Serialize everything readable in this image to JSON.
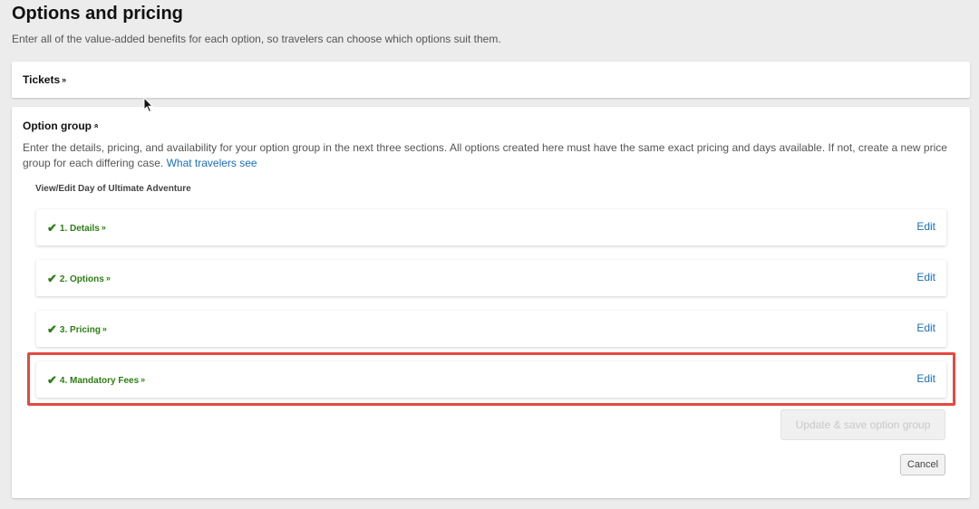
{
  "header": {
    "title": "Options and pricing",
    "subtitle": "Enter all of the value-added benefits for each option, so travelers can choose which options suit them."
  },
  "tickets": {
    "label": "Tickets",
    "toggle_icon": "double-chevron-down-icon"
  },
  "option_group": {
    "label": "Option group",
    "toggle_icon": "double-chevron-up-icon",
    "description": "Enter the details, pricing, and availability for your option group in the next three sections. All options created here must have the same exact pricing and days available. If not, create a new price group for each differing case.",
    "link_text": "What travelers see",
    "view_edit_label": "View/Edit Day of Ultimate Adventure",
    "steps": [
      {
        "label": "1. Details",
        "edit_label": "Edit",
        "status_icon": "checkmark-icon"
      },
      {
        "label": "2. Options",
        "edit_label": "Edit",
        "status_icon": "checkmark-icon"
      },
      {
        "label": "3. Pricing",
        "edit_label": "Edit",
        "status_icon": "checkmark-icon"
      },
      {
        "label": "4. Mandatory Fees",
        "edit_label": "Edit",
        "status_icon": "checkmark-icon"
      }
    ],
    "save_button_label": "Update & save option group",
    "cancel_button_label": "Cancel"
  },
  "colors": {
    "accent_link": "#1a6fb5",
    "success_green": "#2e7d15",
    "highlight_red": "#e5493f",
    "background": "#ececec"
  }
}
